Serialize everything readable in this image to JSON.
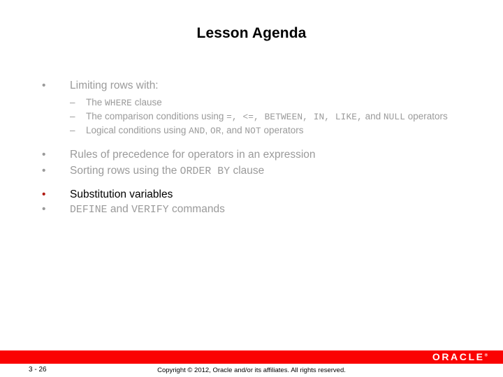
{
  "slide": {
    "title": "Lesson Agenda",
    "agenda": [
      {
        "id": "limiting-rows",
        "text": "Limiting rows with:",
        "active": false,
        "sub": [
          {
            "id": "where-clause",
            "runs": [
              {
                "t": "The ",
                "mono": false
              },
              {
                "t": "WHERE",
                "mono": true
              },
              {
                "t": " clause",
                "mono": false
              }
            ]
          },
          {
            "id": "comparison-conditions",
            "runs": [
              {
                "t": "The comparison conditions using ",
                "mono": false
              },
              {
                "t": "=, <=, BETWEEN, IN, LIKE,",
                "mono": true
              },
              {
                "t": " and ",
                "mono": false
              },
              {
                "t": "NULL",
                "mono": true
              },
              {
                "t": " operators",
                "mono": false
              }
            ]
          },
          {
            "id": "logical-conditions",
            "runs": [
              {
                "t": "Logical conditions using ",
                "mono": false
              },
              {
                "t": "AND",
                "mono": true
              },
              {
                "t": ", ",
                "mono": false
              },
              {
                "t": "OR",
                "mono": true
              },
              {
                "t": ", and ",
                "mono": false
              },
              {
                "t": "NOT",
                "mono": true
              },
              {
                "t": " operators",
                "mono": false
              }
            ]
          }
        ]
      },
      {
        "id": "rules-of-precedence",
        "active": false,
        "runs": [
          {
            "t": "Rules of precedence for operators in an expression",
            "mono": false
          }
        ]
      },
      {
        "id": "sorting-rows",
        "active": false,
        "runs": [
          {
            "t": "Sorting rows using the ",
            "mono": false
          },
          {
            "t": "ORDER BY",
            "mono": true
          },
          {
            "t": " clause",
            "mono": false
          }
        ]
      },
      {
        "id": "substitution-variables",
        "active": true,
        "runs": [
          {
            "t": "Substitution variables",
            "mono": false
          }
        ]
      },
      {
        "id": "define-verify-commands",
        "active": false,
        "runs": [
          {
            "t": "DEFINE",
            "mono": true
          },
          {
            "t": " and ",
            "mono": false
          },
          {
            "t": "VERIFY",
            "mono": true
          },
          {
            "t": " commands",
            "mono": false
          }
        ]
      }
    ],
    "markers": {
      "level1": "•",
      "level2": "–"
    }
  },
  "footer": {
    "page_number": "3 - 26",
    "copyright": "Copyright © 2012, Oracle and/or its affiliates. All rights reserved.",
    "logo_text": "ORACLE",
    "logo_tm": "®"
  },
  "colors": {
    "brand_red": "#fa0202",
    "accent_red": "#b01a12",
    "body_gray": "#9a9a9a",
    "active_black": "#000000"
  }
}
